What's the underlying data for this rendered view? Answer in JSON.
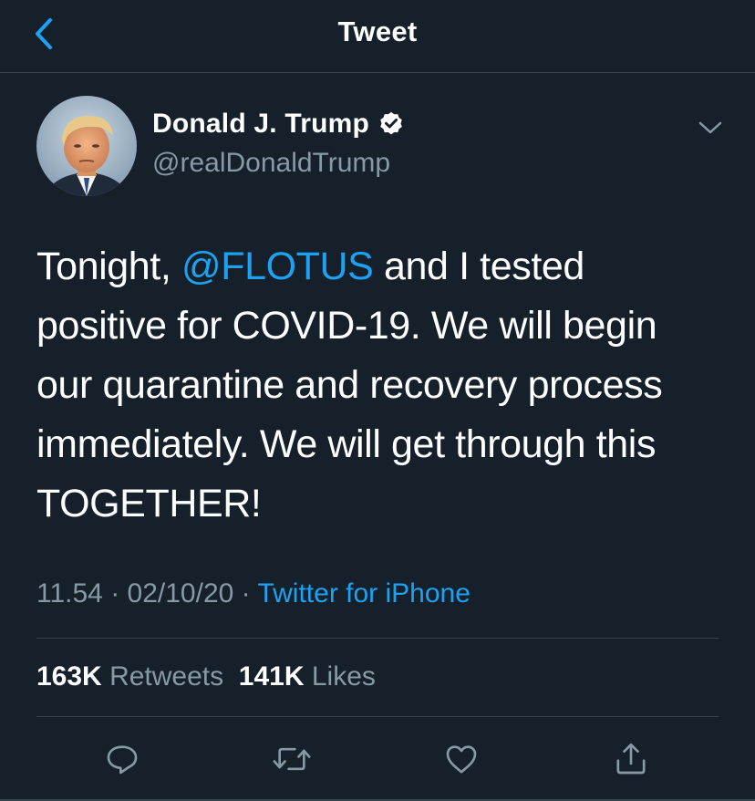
{
  "nav": {
    "title": "Tweet",
    "back_icon": "chevron-left-icon"
  },
  "author": {
    "name": "Donald J. Trump",
    "handle": "@realDonaldTrump",
    "verified": true
  },
  "tweet": {
    "text_before_mention": "Tonight, ",
    "mention": "@FLOTUS",
    "text_after_mention": " and I tested positive for COVID-19. We will begin our quarantine and recovery process immediately. We will get through this TOGETHER!"
  },
  "meta": {
    "time": "11.54",
    "separator": "·",
    "date": "02/10/20",
    "source": "Twitter for iPhone"
  },
  "stats": {
    "retweets_count": "163K",
    "retweets_label": "Retweets",
    "likes_count": "141K",
    "likes_label": "Likes"
  },
  "actions": [
    "reply-icon",
    "retweet-icon",
    "like-icon",
    "share-icon"
  ],
  "colors": {
    "background": "#15202b",
    "accent": "#1da1f2",
    "secondary_text": "#8899a6",
    "divider": "#38444d"
  }
}
